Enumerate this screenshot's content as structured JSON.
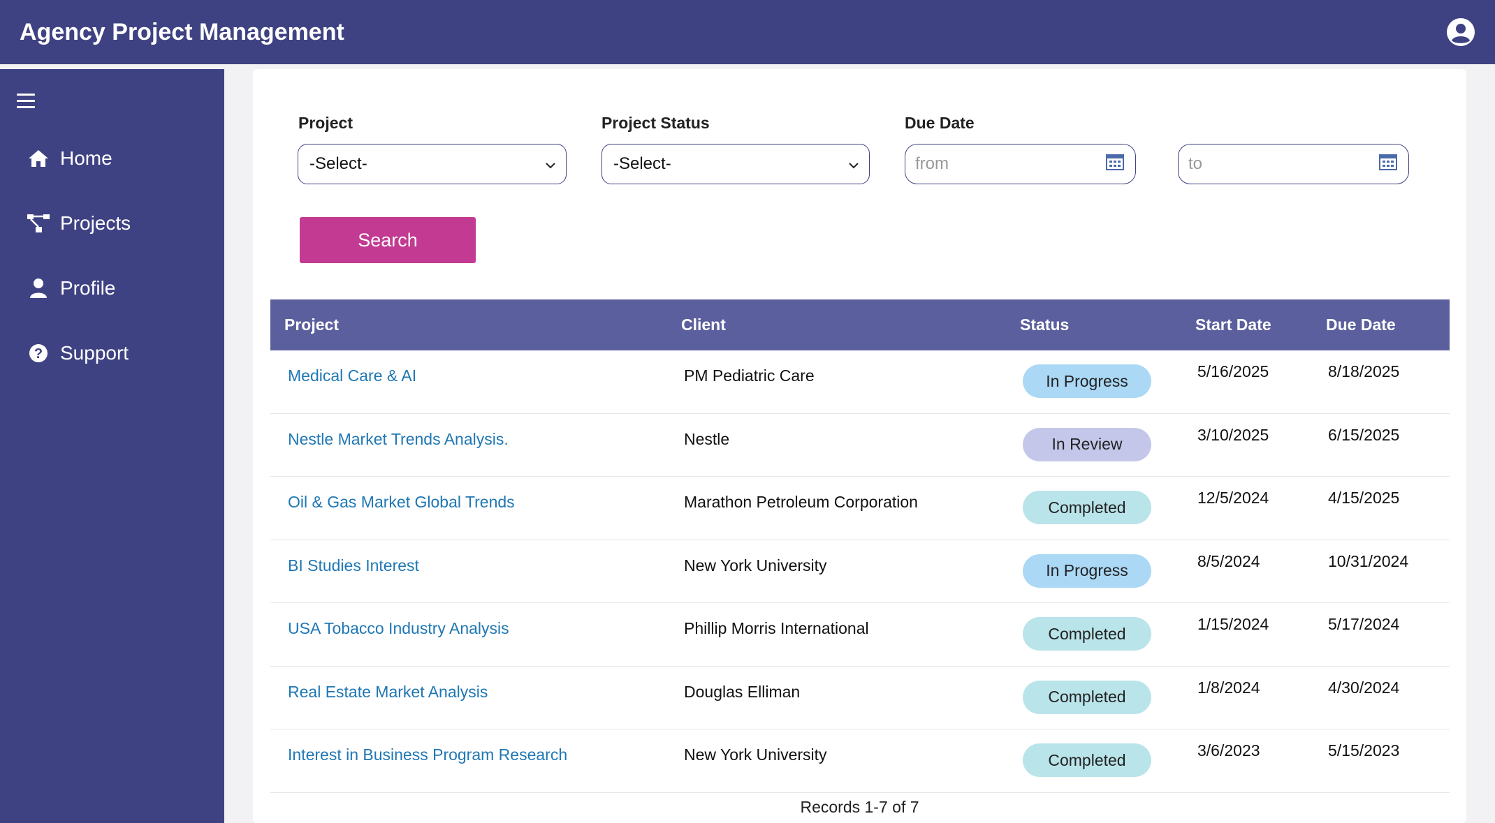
{
  "app": {
    "title": "Agency Project Management"
  },
  "sidebar": {
    "items": [
      {
        "label": "Home",
        "icon": "home-icon"
      },
      {
        "label": "Projects",
        "icon": "projects-icon"
      },
      {
        "label": "Profile",
        "icon": "user-icon"
      },
      {
        "label": "Support",
        "icon": "help-icon"
      }
    ]
  },
  "filters": {
    "project_label": "Project",
    "project_value": "-Select-",
    "status_label": "Project Status",
    "status_value": "-Select-",
    "due_date_label": "Due Date",
    "from_placeholder": "from",
    "to_placeholder": "to",
    "search_label": "Search"
  },
  "table": {
    "headers": [
      "Project",
      "Client",
      "Status",
      "Start Date",
      "Due Date"
    ],
    "rows": [
      {
        "project": "Medical Care & AI",
        "client": "PM Pediatric Care",
        "status": "In Progress",
        "start": "5/16/2025",
        "due": "8/18/2025"
      },
      {
        "project": "Nestle Market Trends Analysis.",
        "client": "Nestle",
        "status": "In Review",
        "start": "3/10/2025",
        "due": "6/15/2025"
      },
      {
        "project": "Oil & Gas Market Global Trends",
        "client": "Marathon Petroleum Corporation",
        "status": "Completed",
        "start": "12/5/2024",
        "due": "4/15/2025"
      },
      {
        "project": "BI Studies Interest",
        "client": "New York University",
        "status": "In Progress",
        "start": "8/5/2024",
        "due": "10/31/2024"
      },
      {
        "project": "USA Tobacco Industry Analysis",
        "client": "Phillip Morris International",
        "status": "Completed",
        "start": "1/15/2024",
        "due": "5/17/2024"
      },
      {
        "project": "Real Estate Market Analysis",
        "client": "Douglas Elliman",
        "status": "Completed",
        "start": "1/8/2024",
        "due": "4/30/2024"
      },
      {
        "project": "Interest in Business Program Research",
        "client": "New York University",
        "status": "Completed",
        "start": "3/6/2023",
        "due": "5/15/2023"
      }
    ],
    "records_text": "Records 1-7 of 7"
  },
  "colors": {
    "brand": "#3f4282",
    "table_header": "#5b5f9e",
    "search_button": "#c23a91",
    "link": "#1f77b4",
    "badge_in_progress": "#aad8f5",
    "badge_in_review": "#c5c7ea",
    "badge_completed": "#b9e4ea"
  }
}
